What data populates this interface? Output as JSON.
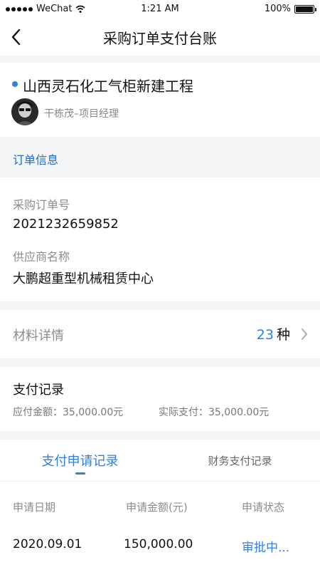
{
  "status_bar": {
    "carrier": "WeChat",
    "time": "1:21 AM",
    "battery_text": "100%",
    "battery_level": 1.0
  },
  "nav": {
    "title": "采购订单支付台账",
    "back_icon": "chevron-left-icon"
  },
  "project": {
    "name": "山西灵石化工气柜新建工程",
    "manager": "干栋茂–项目经理",
    "dot_color": "#2f7fe0"
  },
  "order_info": {
    "section_title": "订单信息",
    "po_label": "采购订单号",
    "po_value": "2021232659852",
    "supplier_label": "供应商名称",
    "supplier_value": "大鹏超重型机械租赁中心"
  },
  "material": {
    "label": "材料详情",
    "count": "23",
    "unit": "种"
  },
  "payment": {
    "title": "支付记录",
    "payable": "应付金额：35,000.00元",
    "actual": "实际支付：35,000.00元"
  },
  "tabs": [
    {
      "label": "支付申请记录",
      "active": true
    },
    {
      "label": "财务支付记录",
      "active": false
    }
  ],
  "table": {
    "headers": [
      "申请日期",
      "申请金额(元)",
      "申请状态"
    ],
    "rows": [
      [
        "2020.09.01",
        "150,000.00",
        "审批中..."
      ]
    ]
  },
  "colors": {
    "accent": "#2f7fe0",
    "section_title": "#1f6dc8",
    "background": "#f3f4f6"
  }
}
